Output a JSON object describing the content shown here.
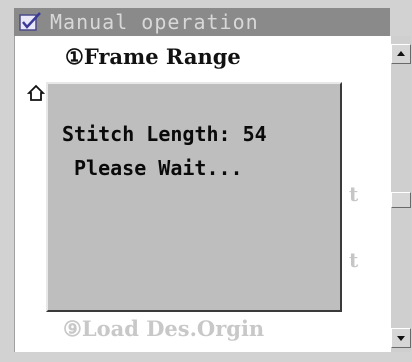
{
  "window": {
    "title": "Manual operation"
  },
  "list": {
    "items": [
      {
        "label": "①Frame Range"
      },
      {
        "label": "⑨Load Des.Orgin"
      }
    ],
    "ghost_chars": [
      "t",
      "t"
    ]
  },
  "dialog": {
    "line1": "Stitch Length: 54",
    "line2": "Please Wait..."
  },
  "icons": {
    "title_icon": "checkbox-icon",
    "left_glyph": "home-icon",
    "scroll_up": "arrow-up-icon",
    "scroll_down": "arrow-down-icon"
  },
  "colors": {
    "titlebar_bg": "#8a8a8a",
    "dialog_bg": "#bebebe",
    "list_bg": "#ffffff"
  }
}
